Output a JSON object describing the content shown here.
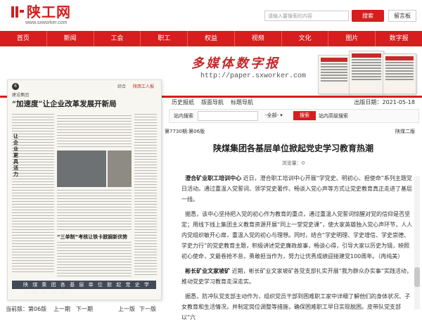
{
  "header": {
    "logo_text": "陕工网",
    "logo_url": "www.sxworker.com",
    "search_placeholder": "请输入要搜索的内容",
    "search_button": "搜索",
    "message_button": "留言板"
  },
  "nav": {
    "items": [
      "首页",
      "新闻",
      "工会",
      "职工",
      "权益",
      "视频",
      "文化",
      "图片",
      "数字报"
    ]
  },
  "banner": {
    "title": "多媒体数字报",
    "url": "http://paper.sxworker.com"
  },
  "subnav": {
    "items": [
      "历史报纸",
      "版面导航",
      "标题导航"
    ],
    "date_label": "出版日期：2021-05-18"
  },
  "search_bar": {
    "label": "站内搜索",
    "select_value": "-全部-",
    "button": "搜索",
    "advanced": "站内高级搜索"
  },
  "page_info": {
    "left": "第7730期:第06版",
    "right": "陕煤二版"
  },
  "article": {
    "title": "陕煤集团各基层单位掀起党史学习教育热潮",
    "meta": "浏览量：0",
    "paragraphs": [
      {
        "lead": "澄合矿业职工培训中心",
        "text": "近日，澄合职工培训中心开展“学党史、明初心、担使命”系列主题党日活动。通过重温入党誓词、领学党史著作、畅谈入党心声等方式让党史教育真正走进了基层一线。"
      },
      {
        "lead": "",
        "text": "据悉，该中心坚持把入党的初心作为教育的重点，通过重温入党誓词惊醒对党的信仰是否坚定；用线下线上集团主义教育资源开展“同上一堂党史课”，使大家英雄独入党心声环节，人人内党组织敏开心扉，重温入党的初心与理想。同时，结合“学史明理、学史增信、学史崇德、学史力行”的党史教育主题，积极讲述党史廉政故事，畅谈心得，引导大家以历史为镜，映照初心使命，文最卷抢不怠，勇敢担当作为，努力让优秀成绩迎接建党100周年。（冉纯美）"
      },
      {
        "lead": "彬长矿业文家坡矿",
        "text": "近期，彬长矿业文家坡矿各党支部扎实开展“我为群众办实事”实践活动，推动党史学习教育走深走实。"
      },
      {
        "lead": "",
        "text": "据悉，防冲队党支部主动作为，组织党员干部到困难职工家中详细了解他们的身体状况、子女教育和生活情况，并制定岗位调整等措施，确保困难职工早日实现脱困。皮带队党支部以“六"
      }
    ]
  },
  "left_page": {
    "header_left": "综合",
    "header_right": "陕西工人报",
    "column_label": "建设集团",
    "headline": "“加速度”让企业改革发展开新局",
    "mid_title": "“三单制”考核让铁卡掀掘新优势",
    "band_text": "陕 煤 集 团 各 基 层 单 位 掀 起 党 史 学 习 教 育 热 潮",
    "side_title": "让企业更具活力",
    "page_num": "6"
  },
  "bottom_nav": {
    "current": "当前版：第06版",
    "prev_page": "上一期",
    "next_page": "下一期",
    "prev_ver": "上一版",
    "next_ver": "下一版"
  },
  "colors": {
    "brand_red": "#d71d1d"
  }
}
